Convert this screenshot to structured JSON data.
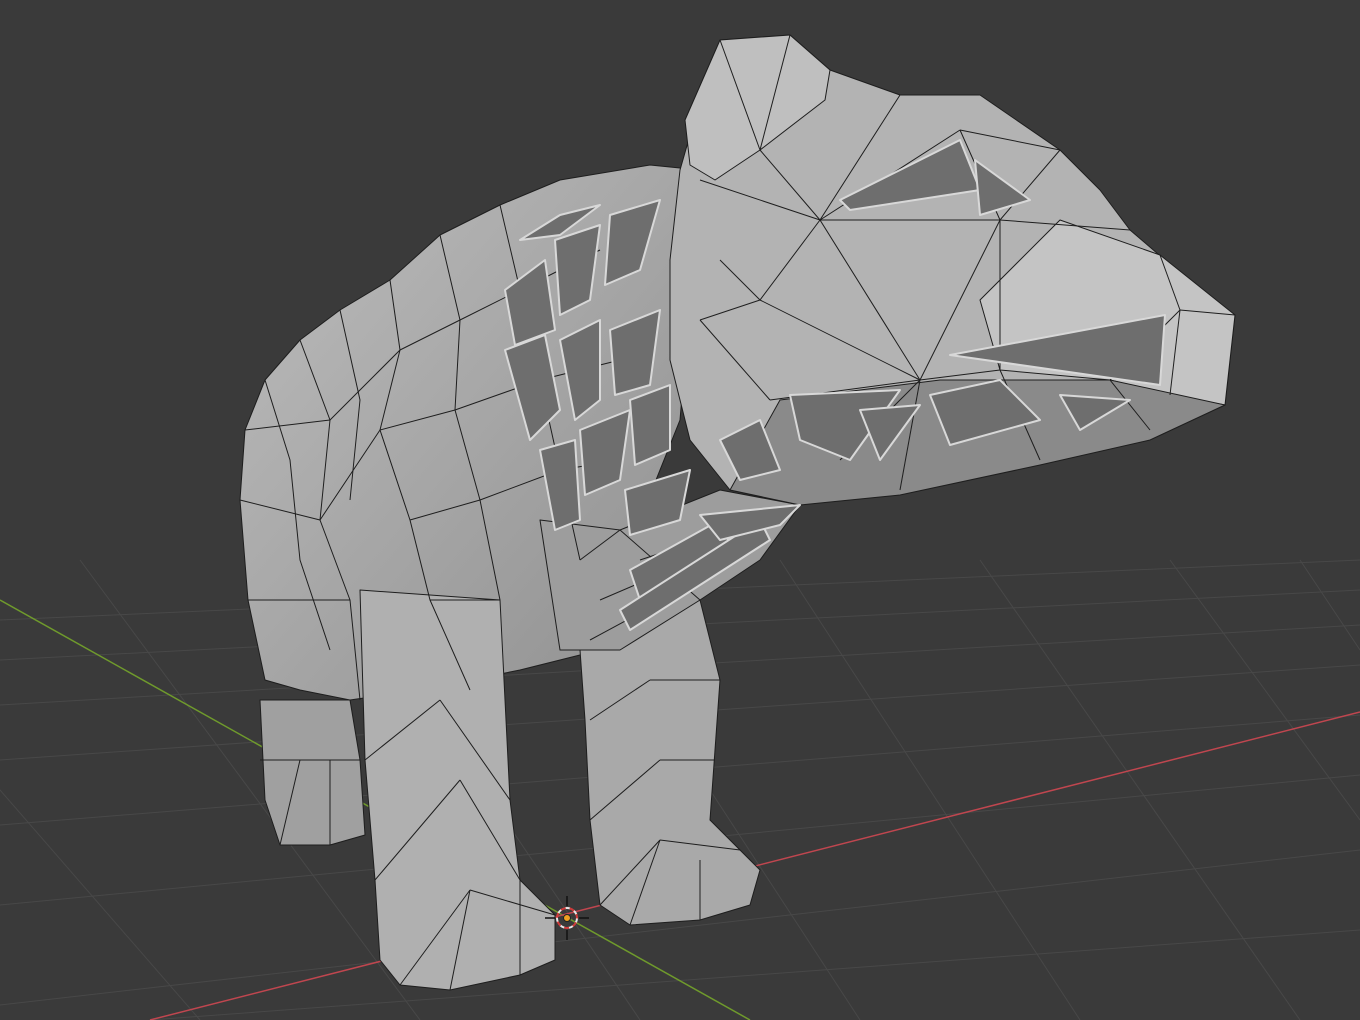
{
  "viewport": {
    "mode": "solid-shading",
    "background_color": "#3a3a3a",
    "grid_color": "#4a4a4a",
    "x_axis_color": "#c0464f",
    "y_axis_color": "#6f9a2c"
  },
  "scene": {
    "object_icon": "bear-lowpoly-mesh",
    "mesh_fill_color": "#a7a7a7",
    "wire_color": "#1e1e1e",
    "cursor_icon": "3d-cursor-icon",
    "origin_icon": "origin-dot-icon",
    "origin_color": "#f0a020"
  }
}
